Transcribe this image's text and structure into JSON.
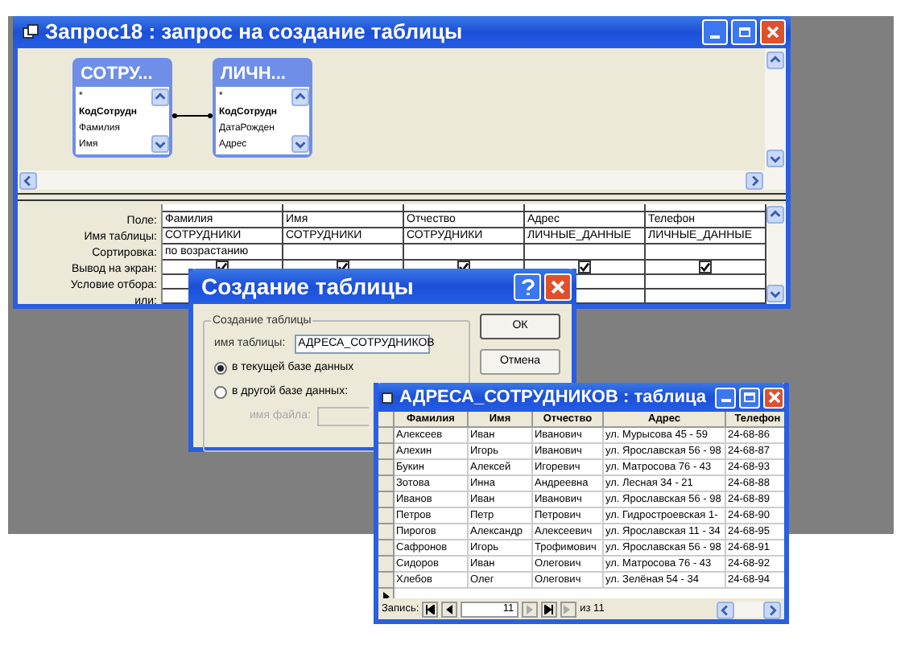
{
  "query_window": {
    "title": "Запрос18 : запрос на создание таблицы",
    "field_lists": [
      {
        "title": "СОТРУ...",
        "fields": [
          {
            "name": "*",
            "primary_key": false
          },
          {
            "name": "КодСотрудн",
            "primary_key": true
          },
          {
            "name": "Фамилия",
            "primary_key": false
          },
          {
            "name": "Имя",
            "primary_key": false
          }
        ]
      },
      {
        "title": "ЛИЧН...",
        "fields": [
          {
            "name": "*",
            "primary_key": false
          },
          {
            "name": "КодСотрудн",
            "primary_key": true
          },
          {
            "name": "ДатаРожден",
            "primary_key": false
          },
          {
            "name": "Адрес",
            "primary_key": false
          }
        ]
      }
    ],
    "grid": {
      "row_labels": [
        "Поле:",
        "Имя таблицы:",
        "Сортировка:",
        "Вывод на экран:",
        "Условие отбора:",
        "или:"
      ],
      "columns": [
        {
          "field": "Фамилия",
          "table": "СОТРУДНИКИ",
          "sort": "по возрастанию",
          "show": true
        },
        {
          "field": "Имя",
          "table": "СОТРУДНИКИ",
          "show": true
        },
        {
          "field": "Отчество",
          "table": "СОТРУДНИКИ",
          "show": true
        },
        {
          "field": "Адрес",
          "table": "ЛИЧНЫЕ_ДАННЫЕ",
          "show": true
        },
        {
          "field": "Телефон",
          "table": "ЛИЧНЫЕ_ДАННЫЕ",
          "show": true
        }
      ]
    }
  },
  "dialog": {
    "title": "Создание таблицы",
    "group_label": "Создание таблицы",
    "name_label": "имя таблицы:",
    "name_value": "АДРЕСА_СОТРУДНИКОВ",
    "options": [
      {
        "label": "в текущей базе данных",
        "selected": true
      },
      {
        "label": "в другой базе данных:",
        "selected": false
      }
    ],
    "file_label": "имя файла:",
    "buttons": [
      "ОК",
      "Отмена"
    ]
  },
  "table_window": {
    "title": "АДРЕСА_СОТРУДНИКОВ : таблица",
    "columns": [
      "Фамилия",
      "Имя",
      "Отчество",
      "Адрес",
      "Телефон"
    ],
    "rows": [
      [
        "Алексеев",
        "Иван",
        "Иванович",
        "ул. Мурысова 45 - 59",
        "24-68-86"
      ],
      [
        "Алехин",
        "Игорь",
        "Иванович",
        "ул. Ярославская 56 - 98",
        "24-68-87"
      ],
      [
        "Букин",
        "Алексей",
        "Игоревич",
        "ул. Матросова 76 - 43",
        "24-68-93"
      ],
      [
        "Зотова",
        "Инна",
        "Андреевна",
        "ул. Лесная 34 - 21",
        "24-68-88"
      ],
      [
        "Иванов",
        "Иван",
        "Иванович",
        "ул. Ярославская 56 - 98",
        "24-68-89"
      ],
      [
        "Петров",
        "Петр",
        "Петрович",
        "ул. Гидростроевская 1-",
        "24-68-90"
      ],
      [
        "Пирогов",
        "Александр",
        "Алексеевич",
        "ул. Ярославская 11 - 34",
        "24-68-95"
      ],
      [
        "Сафронов",
        "Игорь",
        "Трофимович",
        "ул. Ярославская 56 - 98",
        "24-68-91"
      ],
      [
        "Сидоров",
        "Иван",
        "Олегович",
        "ул. Матросова 76 - 43",
        "24-68-92"
      ],
      [
        "Хлебов",
        "Олег",
        "Олегович",
        "ул. Зелёная 54 - 34",
        "24-68-94"
      ]
    ],
    "nav": {
      "label": "Запись:",
      "current": "11",
      "total": "из 11"
    }
  }
}
